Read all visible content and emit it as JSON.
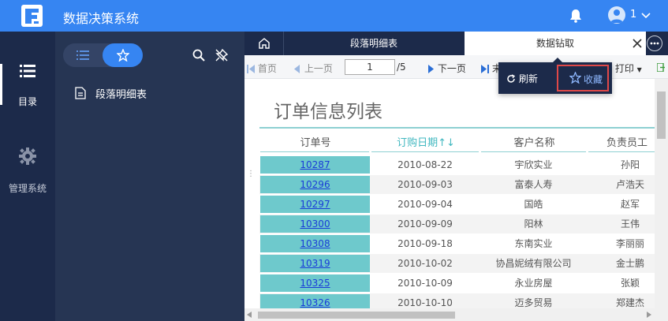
{
  "header": {
    "app_title": "数据决策系统",
    "user_count": "1",
    "icons": [
      "logo-icon",
      "bell-icon",
      "avatar-icon",
      "chevron-down-icon"
    ]
  },
  "rail": {
    "items": [
      {
        "label": "目录",
        "icon": "list-icon",
        "active": true
      },
      {
        "label": "管理系统",
        "icon": "gear-icon",
        "active": false
      }
    ]
  },
  "panel": {
    "tree": [
      {
        "label": "段落明细表",
        "icon": "document-icon"
      }
    ]
  },
  "tabs": [
    {
      "label": "段落明细表",
      "active": false
    },
    {
      "label": "数据钻取",
      "active": true
    }
  ],
  "toolbar": {
    "first": "首页",
    "prev": "上一页",
    "page_value": "1",
    "total": "/5",
    "next": "下一页",
    "last": "末",
    "print": "打印"
  },
  "popup": {
    "refresh": "刷新",
    "favorite": "收藏"
  },
  "report": {
    "title": "订单信息列表",
    "columns": [
      "订单号",
      "订购日期↑↓",
      "客户名称",
      "负责员工"
    ],
    "rows": [
      [
        "10287",
        "2010-08-22",
        "宇欣实业",
        "孙阳"
      ],
      [
        "10296",
        "2010-09-03",
        "富泰人寿",
        "卢浩天"
      ],
      [
        "10297",
        "2010-09-04",
        "国皓",
        "赵军"
      ],
      [
        "10300",
        "2010-09-09",
        "阳林",
        "王伟"
      ],
      [
        "10308",
        "2010-09-18",
        "东南实业",
        "李丽丽"
      ],
      [
        "10319",
        "2010-10-02",
        "协昌妮绒有限公司",
        "金士鹏"
      ],
      [
        "10325",
        "2010-10-09",
        "永业房屋",
        "张颖"
      ],
      [
        "10326",
        "2010-10-10",
        "迈多贸易",
        "郑建杰"
      ]
    ]
  },
  "colors": {
    "header_bg": "#3685f2",
    "rail_bg": "#1c2a4a",
    "panel_bg": "#263553",
    "id_cell_bg": "#6ec9cc",
    "sort_header": "#42b8c0",
    "highlight_border": "#e04848"
  }
}
